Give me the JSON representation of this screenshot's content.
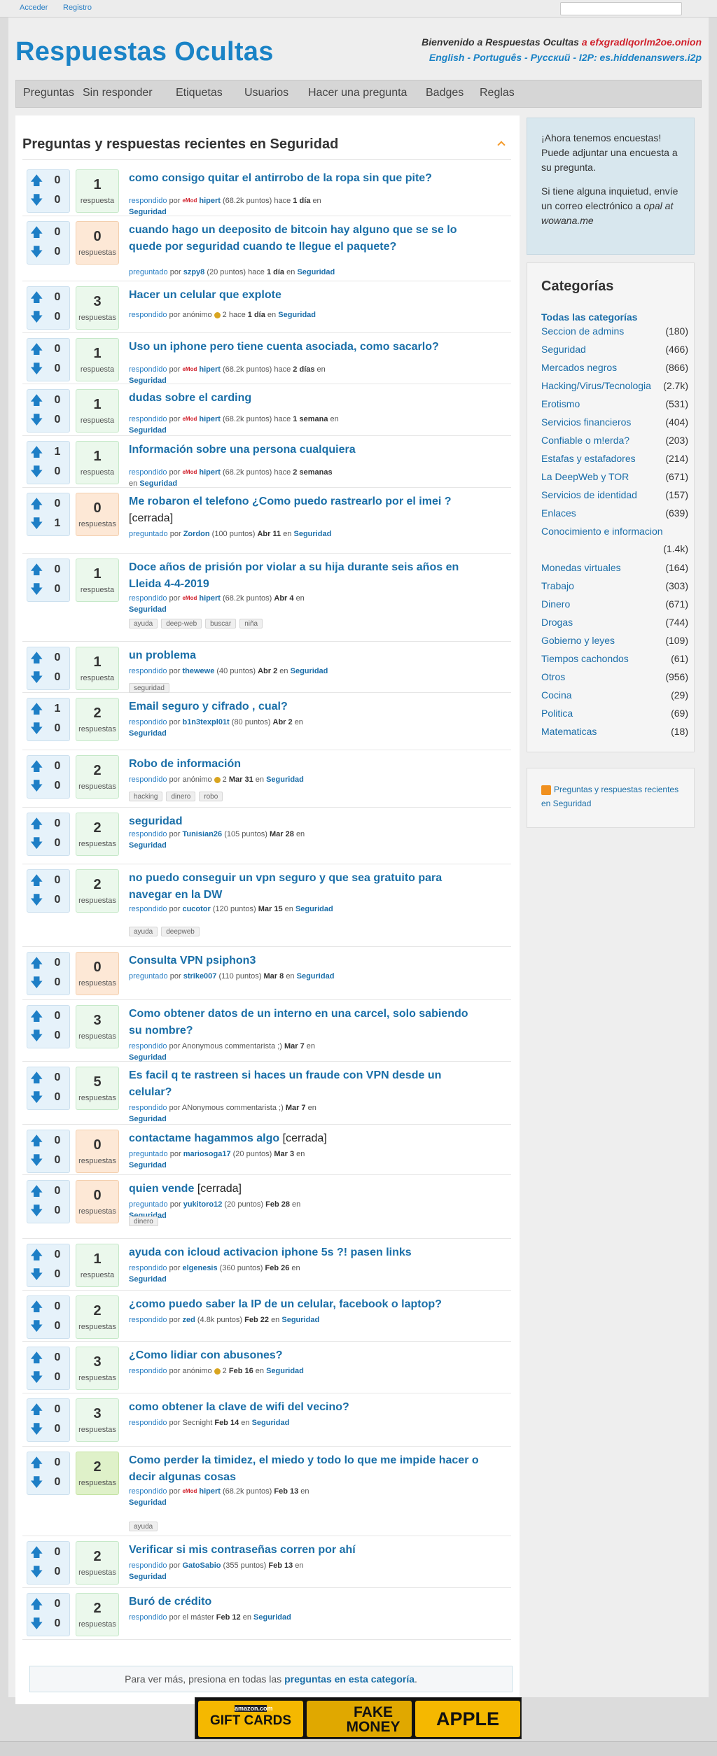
{
  "topbar": {
    "login": "Acceder",
    "register": "Registro"
  },
  "site": {
    "logo": "Respuestas Ocultas",
    "welcome_text": "Bienvenido a Respuestas Ocultas",
    "onion": "a efxgradlqorlm2oe.onion",
    "langs": "English - Português - Русский - I2P:",
    "i2p": "es.hiddenanswers.i2p"
  },
  "nav": [
    "Preguntas",
    "Sin responder",
    "Etiquetas",
    "Usuarios",
    "Hacer una pregunta",
    "Badges",
    "Reglas"
  ],
  "main": {
    "heading": "Preguntas y respuestas recientes en Seguridad"
  },
  "questions": [
    {
      "up": "0",
      "down": "0",
      "ans": "1",
      "ans_label": "respuesta",
      "title": "como consigo quitar el antirrobo de la ropa sin que pite?",
      "closed": "",
      "kw": "respondido",
      "por": "por",
      "mod": "eMod",
      "user": "hipert",
      "pts": "(68.2k puntos)",
      "when_pre": "hace",
      "when": "1 día",
      "en": "en",
      "cat": "Seguridad",
      "tags": []
    },
    {
      "up": "0",
      "down": "0",
      "ans": "0",
      "ans_label": "respuestas",
      "title": "cuando hago un deeposito de bitcoin hay alguno que se se lo quede por seguridad cuando te llegue el paquete?",
      "closed": "",
      "kw": "preguntado",
      "por": "por",
      "mod": "",
      "user": "szpy8",
      "pts": "(20 puntos)",
      "when_pre": "hace",
      "when": "1 día",
      "en": "en",
      "cat": "Seguridad",
      "tags": []
    },
    {
      "up": "0",
      "down": "0",
      "ans": "3",
      "ans_label": "respuestas",
      "title": "Hacer un celular que explote",
      "closed": "",
      "kw": "respondido",
      "por": "por",
      "mod": "",
      "user": "anónimo",
      "pts": "2",
      "when_pre": "hace",
      "when": "1 día",
      "en": "en",
      "cat": "Seguridad",
      "tags": [],
      "anon": true
    },
    {
      "up": "0",
      "down": "0",
      "ans": "1",
      "ans_label": "respuesta",
      "title": "Uso un iphone pero tiene cuenta asociada, como sacarlo?",
      "closed": "",
      "kw": "respondido",
      "por": "por",
      "mod": "eMod",
      "user": "hipert",
      "pts": "(68.2k puntos)",
      "when_pre": "hace",
      "when": "2 días",
      "en": "en",
      "cat": "Seguridad",
      "tags": []
    },
    {
      "up": "0",
      "down": "0",
      "ans": "1",
      "ans_label": "respuesta",
      "title": "dudas sobre el carding",
      "closed": "",
      "kw": "respondido",
      "por": "por",
      "mod": "eMod",
      "user": "hipert",
      "pts": "(68.2k puntos)",
      "when_pre": "hace",
      "when": "1 semana",
      "en": "en",
      "cat": "Seguridad",
      "tags": []
    },
    {
      "up": "1",
      "down": "0",
      "ans": "1",
      "ans_label": "respuesta",
      "title": "Información sobre una persona cualquiera",
      "closed": "",
      "kw": "respondido",
      "por": "por",
      "mod": "eMod",
      "user": "hipert",
      "pts": "(68.2k puntos)",
      "when_pre": "hace",
      "when": "2 semanas",
      "en": "en",
      "cat": "Seguridad",
      "tags": []
    },
    {
      "up": "0",
      "down": "1",
      "ans": "0",
      "ans_label": "respuestas",
      "title": "Me robaron el telefono ¿Como puedo rastrearlo por el imei ?",
      "closed": "[cerrada]",
      "kw": "preguntado",
      "por": "por",
      "mod": "",
      "user": "Zordon",
      "pts": "(100 puntos)",
      "when_pre": "",
      "when": "Abr 11",
      "en": "en",
      "cat": "Seguridad",
      "tags": []
    },
    {
      "up": "0",
      "down": "0",
      "ans": "1",
      "ans_label": "respuesta",
      "title": "Doce años de prisión por violar a su hija durante seis años en Lleida 4-4-2019",
      "closed": "",
      "kw": "respondido",
      "por": "por",
      "mod": "eMod",
      "user": "hipert",
      "pts": "(68.2k puntos)",
      "when_pre": "",
      "when": "Abr 4",
      "en": "en",
      "cat": "Seguridad",
      "tags": [
        "ayuda",
        "deep-web",
        "buscar",
        "niña"
      ]
    },
    {
      "up": "0",
      "down": "0",
      "ans": "1",
      "ans_label": "respuesta",
      "title": "un problema",
      "closed": "",
      "kw": "respondido",
      "por": "por",
      "mod": "",
      "user": "thewewe",
      "pts": "(40 puntos)",
      "when_pre": "",
      "when": "Abr 2",
      "en": "en",
      "cat": "Seguridad",
      "tags": [
        "seguridad"
      ]
    },
    {
      "up": "1",
      "down": "0",
      "ans": "2",
      "ans_label": "respuestas",
      "title": "Email seguro y cifrado , cual?",
      "closed": "",
      "kw": "respondido",
      "por": "por",
      "mod": "",
      "user": "b1n3texpl01t",
      "pts": "(80 puntos)",
      "when_pre": "",
      "when": "Abr 2",
      "en": "en",
      "cat": "Seguridad",
      "tags": []
    },
    {
      "up": "0",
      "down": "0",
      "ans": "2",
      "ans_label": "respuestas",
      "title": "Robo de información",
      "closed": "",
      "kw": "respondido",
      "por": "por",
      "mod": "",
      "user": "anónimo",
      "pts": "2",
      "when_pre": "",
      "when": "Mar 31",
      "en": "en",
      "cat": "Seguridad",
      "tags": [
        "hacking",
        "dinero",
        "robo"
      ],
      "anon": true
    },
    {
      "up": "0",
      "down": "0",
      "ans": "2",
      "ans_label": "respuestas",
      "title": "seguridad",
      "closed": "",
      "kw": "respondido",
      "por": "por",
      "mod": "",
      "user": "Tunisian26",
      "pts": "(105 puntos)",
      "when_pre": "",
      "when": "Mar 28",
      "en": "en",
      "cat": "Seguridad",
      "tags": []
    },
    {
      "up": "0",
      "down": "0",
      "ans": "2",
      "ans_label": "respuestas",
      "title": "no puedo conseguir un vpn seguro y que sea gratuito para navegar en la DW",
      "closed": "",
      "kw": "respondido",
      "por": "por",
      "mod": "",
      "user": "cucotor",
      "pts": "(120 puntos)",
      "when_pre": "",
      "when": "Mar 15",
      "en": "en",
      "cat": "Seguridad",
      "tags": [
        "ayuda",
        "deepweb"
      ]
    },
    {
      "up": "0",
      "down": "0",
      "ans": "0",
      "ans_label": "respuestas",
      "title": "Consulta VPN psiphon3",
      "closed": "",
      "kw": "preguntado",
      "por": "por",
      "mod": "",
      "user": "strike007",
      "pts": "(110 puntos)",
      "when_pre": "",
      "when": "Mar 8",
      "en": "en",
      "cat": "Seguridad",
      "tags": []
    },
    {
      "up": "0",
      "down": "0",
      "ans": "3",
      "ans_label": "respuestas",
      "title": "Como obtener datos de un interno en una carcel, solo sabiendo su nombre?",
      "closed": "",
      "kw": "respondido",
      "por": "por",
      "mod": "",
      "user": "Anonymous commentarista ;)",
      "pts": "",
      "when_pre": "",
      "when": "Mar 7",
      "en": "en",
      "cat": "Seguridad",
      "tags": [],
      "plain": true
    },
    {
      "up": "0",
      "down": "0",
      "ans": "5",
      "ans_label": "respuestas",
      "title": "Es facil q te rastreen si haces un fraude con VPN desde un celular?",
      "closed": "",
      "kw": "respondido",
      "por": "por",
      "mod": "",
      "user": "ANonymous commentarista ;)",
      "pts": "",
      "when_pre": "",
      "when": "Mar 7",
      "en": "en",
      "cat": "Seguridad",
      "tags": [],
      "plain": true
    },
    {
      "up": "0",
      "down": "0",
      "ans": "0",
      "ans_label": "respuestas",
      "title": "contactame hagammos algo",
      "closed": "[cerrada]",
      "kw": "preguntado",
      "por": "por",
      "mod": "",
      "user": "mariosoga17",
      "pts": "(20 puntos)",
      "when_pre": "",
      "when": "Mar 3",
      "en": "en",
      "cat": "Seguridad",
      "tags": []
    },
    {
      "up": "0",
      "down": "0",
      "ans": "0",
      "ans_label": "respuestas",
      "title": "quien vende",
      "closed": "[cerrada]",
      "kw": "preguntado",
      "por": "por",
      "mod": "",
      "user": "yukitoro12",
      "pts": "(20 puntos)",
      "when_pre": "",
      "when": "Feb 28",
      "en": "en",
      "cat": "Seguridad",
      "tags": [
        "dinero"
      ]
    },
    {
      "up": "0",
      "down": "0",
      "ans": "1",
      "ans_label": "respuesta",
      "title": "ayuda con icloud activacion iphone 5s ?! pasen links",
      "closed": "",
      "kw": "respondido",
      "por": "por",
      "mod": "",
      "user": "elgenesis",
      "pts": "(360 puntos)",
      "when_pre": "",
      "when": "Feb 26",
      "en": "en",
      "cat": "Seguridad",
      "tags": []
    },
    {
      "up": "0",
      "down": "0",
      "ans": "2",
      "ans_label": "respuestas",
      "title": "¿como puedo saber la IP de un celular, facebook o laptop?",
      "closed": "",
      "kw": "respondido",
      "por": "por",
      "mod": "",
      "user": "zed",
      "pts": "(4.8k puntos)",
      "when_pre": "",
      "when": "Feb 22",
      "en": "en",
      "cat": "Seguridad",
      "tags": []
    },
    {
      "up": "0",
      "down": "0",
      "ans": "3",
      "ans_label": "respuestas",
      "title": "¿Como lidiar con abusones?",
      "closed": "",
      "kw": "respondido",
      "por": "por",
      "mod": "",
      "user": "anónimo",
      "pts": "2",
      "when_pre": "",
      "when": "Feb 16",
      "en": "en",
      "cat": "Seguridad",
      "tags": [],
      "anon": true
    },
    {
      "up": "0",
      "down": "0",
      "ans": "3",
      "ans_label": "respuestas",
      "title": "como obtener la clave de wifi del vecino?",
      "closed": "",
      "kw": "respondido",
      "por": "por",
      "mod": "",
      "user": "Secnight",
      "pts": "",
      "when_pre": "",
      "when": "Feb 14",
      "en": "en",
      "cat": "Seguridad",
      "tags": [],
      "plain": true
    },
    {
      "up": "0",
      "down": "0",
      "ans": "2",
      "ans_label": "respuestas",
      "title": "Como perder la timidez, el miedo y todo lo que me impide hacer o decir algunas cosas",
      "closed": "",
      "kw": "respondido",
      "por": "por",
      "mod": "eMod",
      "user": "hipert",
      "pts": "(68.2k puntos)",
      "when_pre": "",
      "when": "Feb 13",
      "en": "en",
      "cat": "Seguridad",
      "tags": [
        "ayuda"
      ],
      "best": true
    },
    {
      "up": "0",
      "down": "0",
      "ans": "2",
      "ans_label": "respuestas",
      "title": "Verificar si mis contraseñas corren por ahí",
      "closed": "",
      "kw": "respondido",
      "por": "por",
      "mod": "",
      "user": "GatoSabio",
      "pts": "(355 puntos)",
      "when_pre": "",
      "when": "Feb 13",
      "en": "en",
      "cat": "Seguridad",
      "tags": []
    },
    {
      "up": "0",
      "down": "0",
      "ans": "2",
      "ans_label": "respuestas",
      "title": "Buró de crédito",
      "closed": "",
      "kw": "respondido",
      "por": "por",
      "mod": "",
      "user": "el máster",
      "pts": "",
      "when_pre": "",
      "when": "Feb 12",
      "en": "en",
      "cat": "Seguridad",
      "tags": [],
      "plain": true
    }
  ],
  "more": {
    "text": "Para ver más, presiona en todas las",
    "link": "preguntas en esta categoría",
    "end": "."
  },
  "sidebar": {
    "notice1": "¡Ahora tenemos encuestas! Puede adjuntar una encuesta a su pregunta.",
    "notice2_pre": "Si tiene alguna inquietud, envíe un correo electrónico a",
    "notice2_email": "opal at wowana.me",
    "cat_title": "Categorías",
    "all": "Todas las categorías",
    "categories": [
      {
        "name": "Seccion de admins",
        "count": "(180)"
      },
      {
        "name": "Seguridad",
        "count": "(466)"
      },
      {
        "name": "Mercados negros",
        "count": "(866)"
      },
      {
        "name": "Hacking/Virus/Tecnologia",
        "count": "(2.7k)"
      },
      {
        "name": "Erotismo",
        "count": "(531)"
      },
      {
        "name": "Servicios financieros",
        "count": "(404)"
      },
      {
        "name": "Confiable o m!erda?",
        "count": "(203)"
      },
      {
        "name": "Estafas y estafadores",
        "count": "(214)"
      },
      {
        "name": "La DeepWeb y TOR",
        "count": "(671)"
      },
      {
        "name": "Servicios de identidad",
        "count": "(157)"
      },
      {
        "name": "Enlaces",
        "count": "(639)"
      },
      {
        "name": "Conocimiento e informacion",
        "count": "(1.4k)"
      },
      {
        "name": "Monedas virtuales",
        "count": "(164)"
      },
      {
        "name": "Trabajo",
        "count": "(303)"
      },
      {
        "name": "Dinero",
        "count": "(671)"
      },
      {
        "name": "Drogas",
        "count": "(744)"
      },
      {
        "name": "Gobierno y leyes",
        "count": "(109)"
      },
      {
        "name": "Tiempos cachondos",
        "count": "(61)"
      },
      {
        "name": "Otros",
        "count": "(956)"
      },
      {
        "name": "Cocina",
        "count": "(29)"
      },
      {
        "name": "Politica",
        "count": "(69)"
      },
      {
        "name": "Matematicas",
        "count": "(18)"
      }
    ],
    "rss": "Preguntas y respuestas recientes en Seguridad"
  },
  "ad": {
    "c1_top": "amazon.com",
    "c1": "GIFT CARDS",
    "c2": "FAKE MONEY",
    "c3": "APPLE"
  }
}
